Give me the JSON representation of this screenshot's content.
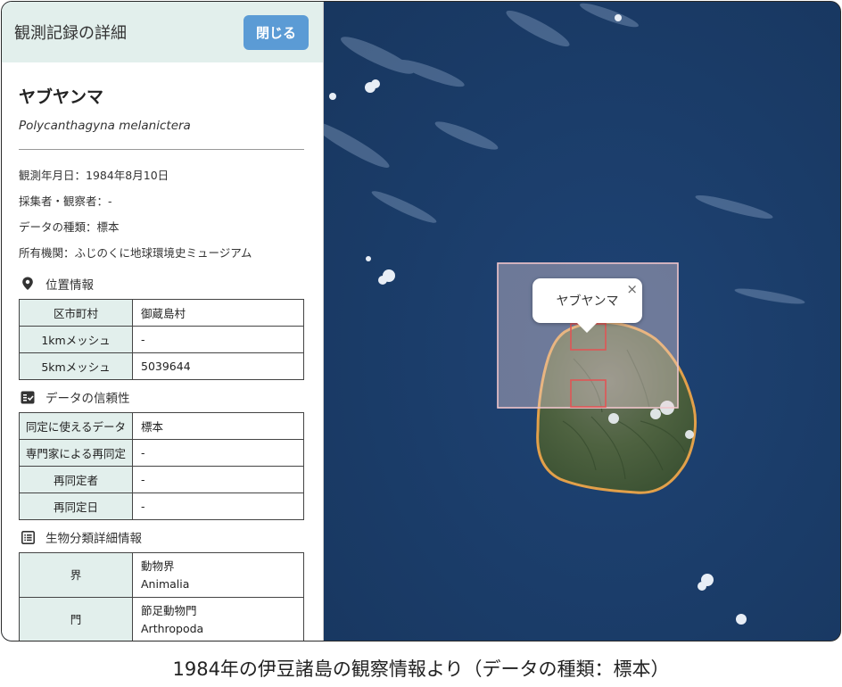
{
  "panel": {
    "title": "観測記録の詳細",
    "close_label": "閉じる",
    "species_ja": "ヤブヤンマ",
    "species_sci": "Polycanthagyna melanictera",
    "meta": [
      "観測年月日：1984年8月10日",
      "採集者・観察者：-",
      "データの種類：標本",
      "所有機関：ふじのくに地球環境史ミュージアム"
    ],
    "location": {
      "title": "位置情報",
      "icon": "map-pin-icon",
      "rows": [
        {
          "key": "区市町村",
          "value": "御蔵島村"
        },
        {
          "key": "1kmメッシュ",
          "value": "-"
        },
        {
          "key": "5kmメッシュ",
          "value": "5039644"
        }
      ]
    },
    "reliability": {
      "title": "データの信頼性",
      "icon": "checklist-icon",
      "rows": [
        {
          "key": "同定に使えるデータ",
          "value": "標本"
        },
        {
          "key": "専門家による再同定",
          "value": "-"
        },
        {
          "key": "再同定者",
          "value": "-"
        },
        {
          "key": "再同定日",
          "value": "-"
        }
      ]
    },
    "taxonomy": {
      "title": "生物分類詳細情報",
      "icon": "list-icon",
      "rows": [
        {
          "key": "界",
          "value_ja": "動物界",
          "value_en": "Animalia"
        },
        {
          "key": "門",
          "value_ja": "節足動物門",
          "value_en": "Arthropoda"
        }
      ]
    }
  },
  "map": {
    "popup_label": "ヤブヤンマ",
    "popup_close": "×",
    "colors": {
      "ocean": "#1f3f6e",
      "island": "#4a5e3c",
      "coast": "#e2a04a",
      "mesh_5km": "#f0c6cc",
      "mesh_1km": "#e05555"
    }
  },
  "caption": "1984年の伊豆諸島の観察情報より（データの種類：標本）"
}
